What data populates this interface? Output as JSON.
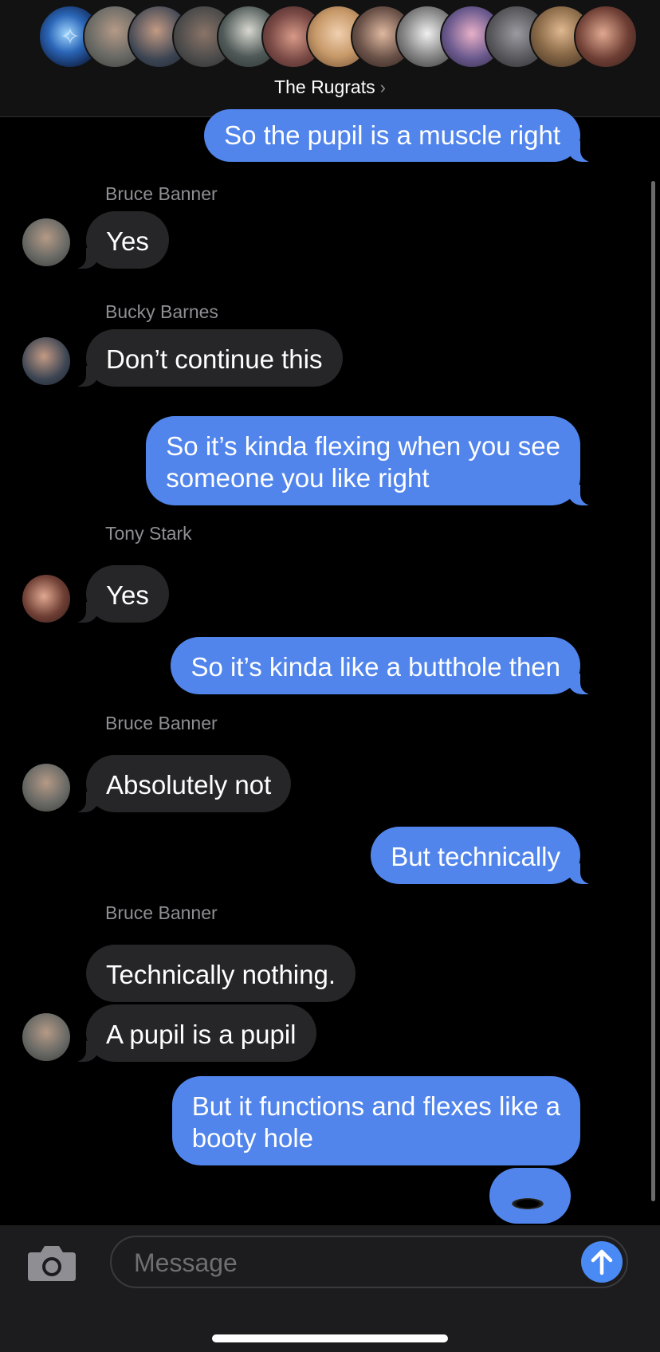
{
  "header": {
    "group_name": "The Rugrats",
    "chevron_icon": "chevron-right-icon",
    "member_avatars": [
      {
        "name": "jellyfish",
        "color": "#1c3a6e"
      },
      {
        "name": "bruce-banner",
        "color": "#6a6a66"
      },
      {
        "name": "bucky-barnes",
        "color": "#3b4452"
      },
      {
        "name": "member-4",
        "color": "#4a4a4a"
      },
      {
        "name": "member-5",
        "color": "#505a58"
      },
      {
        "name": "member-6",
        "color": "#7a4a46"
      },
      {
        "name": "member-7",
        "color": "#c89a6a"
      },
      {
        "name": "member-8",
        "color": "#6a5248"
      },
      {
        "name": "member-9",
        "color": "#8a8a8a"
      },
      {
        "name": "member-10",
        "color": "#6b5a8e"
      },
      {
        "name": "member-11",
        "color": "#5a5a5e"
      },
      {
        "name": "member-12",
        "color": "#8a6a48"
      },
      {
        "name": "tony-stark",
        "color": "#6e3e34"
      }
    ]
  },
  "messages": [
    {
      "type": "outgoing",
      "text": "So the pupil is a muscle right"
    },
    {
      "type": "sender",
      "name": "Bruce Banner"
    },
    {
      "type": "incoming",
      "text": "Yes",
      "avatar": "bruce-banner"
    },
    {
      "type": "sender",
      "name": "Bucky Barnes"
    },
    {
      "type": "incoming",
      "text": "Don’t continue this",
      "avatar": "bucky-barnes"
    },
    {
      "type": "outgoing",
      "line1": "So it’s kinda flexing when you see",
      "line2": "someone you like right"
    },
    {
      "type": "sender",
      "name": "Tony Stark"
    },
    {
      "type": "incoming",
      "text": "Yes",
      "avatar": "tony-stark"
    },
    {
      "type": "outgoing",
      "text": "So it’s kinda like a butthole then"
    },
    {
      "type": "sender",
      "name": "Bruce Banner"
    },
    {
      "type": "incoming",
      "text": "Absolutely not",
      "avatar": "bruce-banner"
    },
    {
      "type": "outgoing",
      "text": "But technically"
    },
    {
      "type": "sender",
      "name": "Bruce Banner"
    },
    {
      "type": "incoming",
      "text": "Technically nothing."
    },
    {
      "type": "incoming",
      "text": "A pupil is a pupil",
      "avatar": "bruce-banner"
    },
    {
      "type": "outgoing",
      "line1": "But it functions and flexes like a",
      "line2": "booty hole"
    },
    {
      "type": "outgoing-emoji",
      "icon": "hole-emoji-icon"
    }
  ],
  "composer": {
    "placeholder": "Message",
    "camera_icon": "camera-icon",
    "send_icon": "arrow-up-icon"
  },
  "colors": {
    "outgoing_bubble": "#5185ec",
    "incoming_bubble": "#262628",
    "send_button": "#4a8af4"
  }
}
